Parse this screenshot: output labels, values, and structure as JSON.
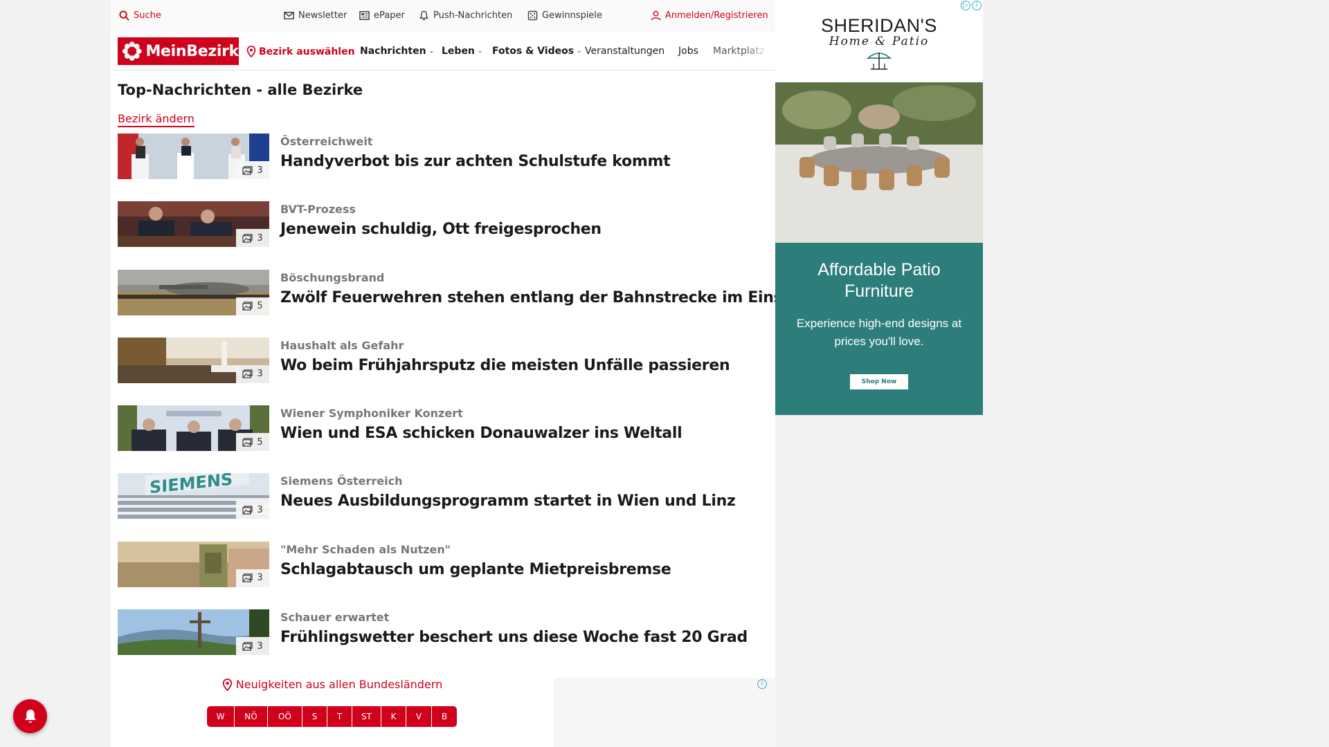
{
  "utility": {
    "search": "Suche",
    "newsletter": "Newsletter",
    "epaper": "ePaper",
    "push": "Push-Nachrichten",
    "games": "Gewinnspiele",
    "login": "Anmelden/Registrieren"
  },
  "nav": {
    "logo": "MeinBezirk",
    "district": "Bezirk auswählen",
    "news": "Nachrichten",
    "life": "Leben",
    "media": "Fotos & Videos",
    "events": "Veranstaltungen",
    "jobs": "Jobs",
    "market": "Marktplatz"
  },
  "main": {
    "title": "Top-Nachrichten - alle Bezirke",
    "change_district": "Bezirk ändern",
    "articles": [
      {
        "kicker": "Österreichweit",
        "headline": "Handyverbot bis zur achten Schulstufe kommt",
        "photos": "3"
      },
      {
        "kicker": "BVT-Prozess",
        "headline": "Jenewein schuldig, Ott freigesprochen",
        "photos": "3"
      },
      {
        "kicker": "Böschungsbrand",
        "headline": "Zwölf Feuerwehren stehen entlang der Bahnstrecke im Einsatz",
        "photos": "5"
      },
      {
        "kicker": "Haushalt als Gefahr",
        "headline": "Wo beim Frühjahrsputz die meisten Unfälle passieren",
        "photos": "3"
      },
      {
        "kicker": "Wiener Symphoniker Konzert",
        "headline": "Wien und ESA schicken Donauwalzer ins Weltall",
        "photos": "5"
      },
      {
        "kicker": "Siemens Österreich",
        "headline": "Neues Ausbildungsprogramm startet in Wien und Linz",
        "photos": "3"
      },
      {
        "kicker": "\"Mehr Schaden als Nutzen\"",
        "headline": "Schlagabtausch um geplante Mietpreisbremse",
        "photos": "3"
      },
      {
        "kicker": "Schauer erwartet",
        "headline": "Frühlingswetter beschert uns diese Woche fast 20 Grad",
        "photos": "3"
      }
    ]
  },
  "bottom": {
    "all_states": "Neuigkeiten aus allen Bundesländern",
    "states": [
      "W",
      "NÖ",
      "OÖ",
      "S",
      "T",
      "ST",
      "K",
      "V",
      "B"
    ]
  },
  "ad": {
    "brand": "SHERIDAN'S",
    "sub": "Home & Patio",
    "headline": "Affordable Patio Furniture",
    "text": "Experience high-end designs at prices you'll love.",
    "button": "Shop Now"
  },
  "colors": {
    "brand_red": "#d0021b",
    "ad_teal": "#2d7d7b"
  }
}
